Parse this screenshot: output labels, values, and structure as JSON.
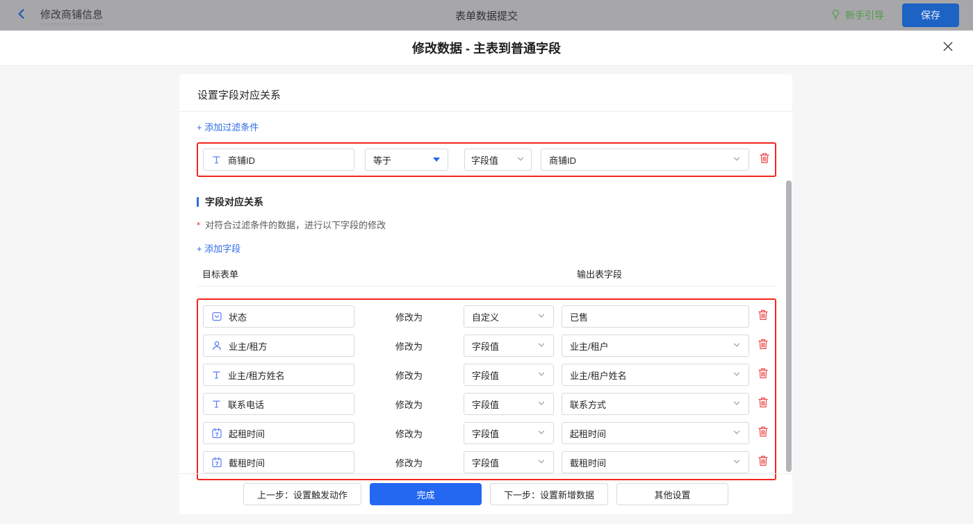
{
  "topbar": {
    "back_title": "修改商铺信息",
    "center_title": "表单数据提交",
    "guide_label": "新手引导",
    "save_label": "保存"
  },
  "modal": {
    "title": "修改数据 - 主表到普通字段"
  },
  "panel": {
    "section_title": "设置字段对应关系",
    "add_filter_label": "+ 添加过滤条件",
    "filter": {
      "field": "商铺ID",
      "field_icon": "text-field",
      "operator": "等于",
      "value_type": "字段值",
      "value": "商铺ID"
    },
    "mapping": {
      "section_title": "字段对应关系",
      "required_mark": "*",
      "note": "对符合过滤条件的数据，进行以下字段的修改",
      "add_field_label": "+ 添加字段",
      "col_left": "目标表单",
      "col_right": "输出表字段",
      "modify_label": "修改为",
      "rows": [
        {
          "target": "状态",
          "icon": "select-field",
          "mode": "自定义",
          "value": "已售",
          "value_kind": "input"
        },
        {
          "target": "业主/租方",
          "icon": "person",
          "mode": "字段值",
          "value": "业主/租户",
          "value_kind": "select"
        },
        {
          "target": "业主/租方姓名",
          "icon": "text-field",
          "mode": "字段值",
          "value": "业主/租户姓名",
          "value_kind": "select"
        },
        {
          "target": "联系电话",
          "icon": "text-field",
          "mode": "字段值",
          "value": "联系方式",
          "value_kind": "select"
        },
        {
          "target": "起租时间",
          "icon": "calendar",
          "mode": "字段值",
          "value": "起租时间",
          "value_kind": "select"
        },
        {
          "target": "截租时间",
          "icon": "calendar",
          "mode": "字段值",
          "value": "截租时间",
          "value_kind": "select"
        }
      ]
    },
    "footer": {
      "prev_label": "上一步：设置触发动作",
      "done_label": "完成",
      "next_label": "下一步：设置新增数据",
      "other_label": "其他设置"
    }
  },
  "colors": {
    "accent_blue": "#2468f2",
    "link_blue": "#2e6be6",
    "highlight_red": "#f5261c",
    "trash_red": "#ee4a4a",
    "field_icon_blue": "#5b7cf8",
    "guide_green": "#4e9b45",
    "save_blue": "#1d63c4"
  }
}
